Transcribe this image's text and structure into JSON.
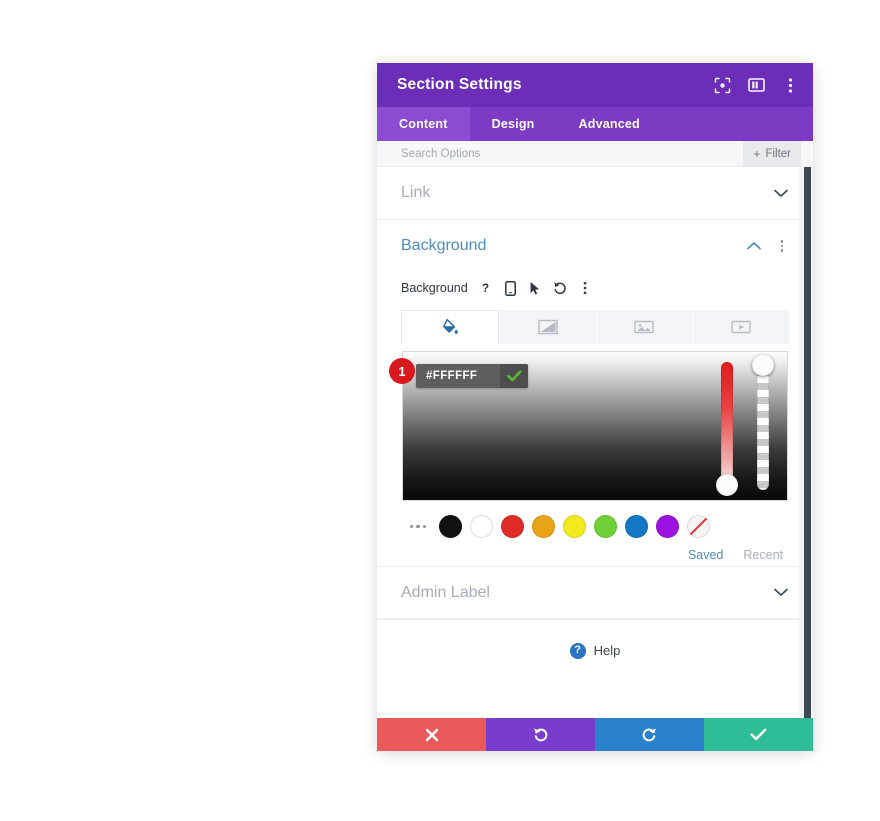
{
  "window": {
    "title": "Section Settings",
    "header_icons": [
      {
        "name": "focus-icon"
      },
      {
        "name": "layout-columns-icon"
      },
      {
        "name": "kebab-menu-icon"
      }
    ],
    "accent_purple": "#6c2eb9",
    "tabbar_purple": "#7d3ac4",
    "active_tab_purple": "#8d4ad2"
  },
  "tabs": [
    {
      "label": "Content",
      "active": true
    },
    {
      "label": "Design",
      "active": false
    },
    {
      "label": "Advanced",
      "active": false
    }
  ],
  "search": {
    "placeholder": "Search Options",
    "value": "",
    "filter_label": "Filter",
    "filter_plus": "+"
  },
  "sections": {
    "link": {
      "label": "Link",
      "expanded": false
    },
    "background": {
      "title": "Background",
      "expanded": true,
      "field_label": "Background",
      "field_icons": [
        {
          "name": "help-question-icon",
          "glyph": "?"
        },
        {
          "name": "mobile-device-icon"
        },
        {
          "name": "hover-cursor-icon"
        },
        {
          "name": "reset-undo-icon"
        },
        {
          "name": "kebab-menu-icon"
        }
      ],
      "type_tabs": [
        {
          "name": "background-color-tab",
          "active": true
        },
        {
          "name": "background-gradient-tab",
          "active": false
        },
        {
          "name": "background-image-tab",
          "active": false
        },
        {
          "name": "background-video-tab",
          "active": false
        }
      ],
      "picker": {
        "badge": "1",
        "hex_value": "#FFFFFF",
        "confirm_icon": "check-icon",
        "hue_slider": {
          "name": "hue-slider",
          "position_pct": 100
        },
        "alpha_slider": {
          "name": "alpha-slider",
          "position_pct": 0
        }
      },
      "swatches": [
        {
          "name": "swatch-more",
          "color": ""
        },
        {
          "name": "swatch-black",
          "color": "#111111"
        },
        {
          "name": "swatch-white",
          "color": "#FFFFFF"
        },
        {
          "name": "swatch-red",
          "color": "#E02B27"
        },
        {
          "name": "swatch-orange",
          "color": "#E8A317"
        },
        {
          "name": "swatch-yellow",
          "color": "#F2EA1C"
        },
        {
          "name": "swatch-green",
          "color": "#6FD137"
        },
        {
          "name": "swatch-blue",
          "color": "#1277C4"
        },
        {
          "name": "swatch-purple",
          "color": "#9C11E0"
        },
        {
          "name": "swatch-transparent",
          "color": "transparent"
        }
      ],
      "palette_tabs": [
        {
          "label": "Saved",
          "active": true
        },
        {
          "label": "Recent",
          "active": false
        }
      ]
    },
    "admin_label": {
      "label": "Admin Label",
      "expanded": false
    }
  },
  "help": {
    "label": "Help",
    "icon_glyph": "?"
  },
  "footer": [
    {
      "name": "cancel-button",
      "icon": "close-x-icon",
      "color": "#ea5a5a"
    },
    {
      "name": "undo-button",
      "icon": "undo-icon",
      "color": "#7a3ccd"
    },
    {
      "name": "redo-button",
      "icon": "redo-icon",
      "color": "#2a82cc"
    },
    {
      "name": "save-button",
      "icon": "check-icon",
      "color": "#2fbd95"
    }
  ]
}
